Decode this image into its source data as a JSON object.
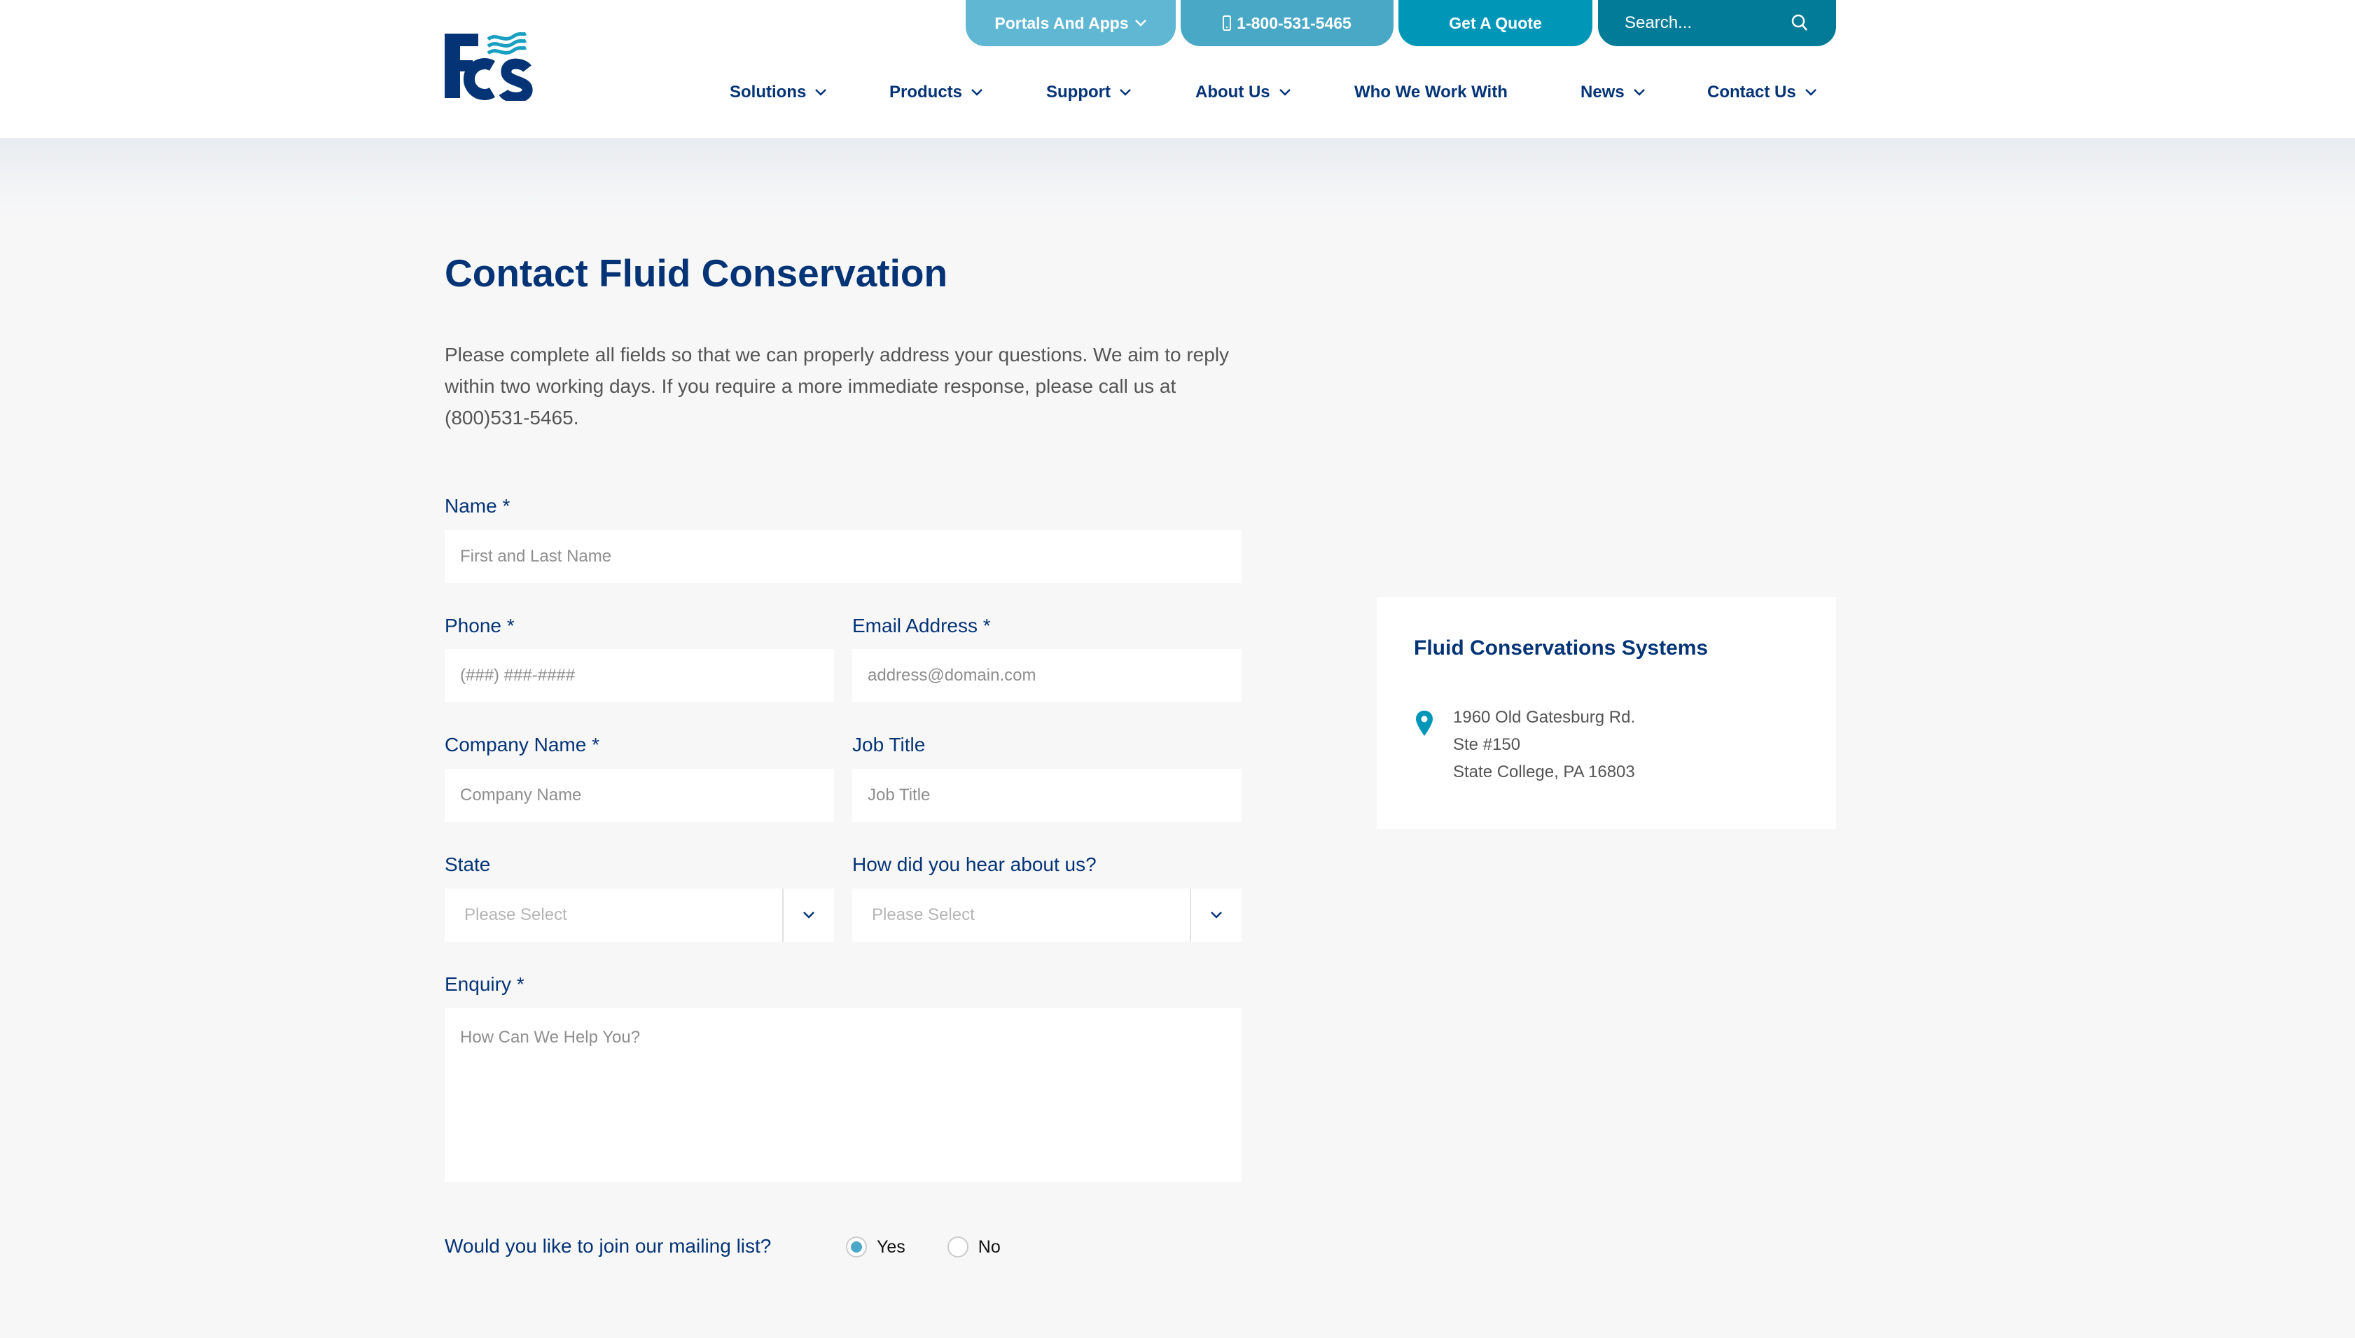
{
  "header": {
    "logo_alt": "FCS",
    "top_buttons": {
      "portals": "Portals And Apps",
      "phone": "1-800-531-5465",
      "quote": "Get A Quote",
      "search_placeholder": "Search..."
    },
    "nav": [
      {
        "label": "Solutions",
        "has_dropdown": true
      },
      {
        "label": "Products",
        "has_dropdown": true
      },
      {
        "label": "Support",
        "has_dropdown": true
      },
      {
        "label": "About Us",
        "has_dropdown": true
      },
      {
        "label": "Who We Work With",
        "has_dropdown": false
      },
      {
        "label": "News",
        "has_dropdown": true
      },
      {
        "label": "Contact Us",
        "has_dropdown": true
      }
    ]
  },
  "main": {
    "title": "Contact Fluid Conservation",
    "intro": "Please complete all fields so that we can properly address your questions. We aim to reply within two working days. If you require a more immediate response, please call us at (800)531-5465.",
    "form": {
      "name": {
        "label": "Name *",
        "placeholder": "First and Last Name",
        "value": ""
      },
      "phone": {
        "label": "Phone *",
        "placeholder": "(###) ###-####",
        "value": ""
      },
      "email": {
        "label": "Email Address *",
        "placeholder": "address@domain.com",
        "value": ""
      },
      "company": {
        "label": "Company Name *",
        "placeholder": "Company Name",
        "value": ""
      },
      "job_title": {
        "label": "Job Title",
        "placeholder": "Job Title",
        "value": ""
      },
      "state": {
        "label": "State",
        "selected": "Please Select"
      },
      "referral": {
        "label": "How did you hear about us?",
        "selected": "Please Select"
      },
      "enquiry": {
        "label": "Enquiry *",
        "placeholder": "How Can We Help You?",
        "value": ""
      },
      "mailing_list": {
        "label": "Would you like to join our mailing list?",
        "options": [
          "Yes",
          "No"
        ],
        "selected": "Yes"
      }
    }
  },
  "card": {
    "title": "Fluid Conservations Systems",
    "address": [
      "1960 Old Gatesburg Rd.",
      "Ste #150",
      "State College, PA 16803"
    ]
  },
  "colors": {
    "brand_navy": "#053476",
    "accent_teal": "#0096b8",
    "search_teal": "#017b97",
    "portals_blue": "#5fb7d4",
    "phone_blue": "#49a8c6",
    "page_bg": "#f7f7f8"
  },
  "icons": {
    "chevron": "chevron-down-icon",
    "phone": "mobile-phone-icon",
    "search": "search-icon",
    "pin": "map-pin-icon"
  }
}
